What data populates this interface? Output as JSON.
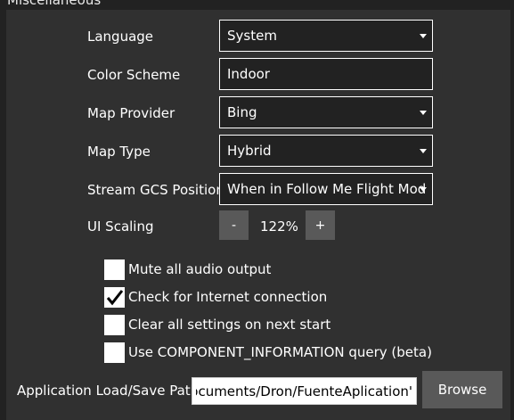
{
  "section_title": "Miscellaneous",
  "rows": {
    "language": {
      "label": "Language",
      "value": "System"
    },
    "color_scheme": {
      "label": "Color Scheme",
      "value": "Indoor"
    },
    "map_provider": {
      "label": "Map Provider",
      "value": "Bing"
    },
    "map_type": {
      "label": "Map Type",
      "value": "Hybrid"
    },
    "stream_gcs": {
      "label": "Stream GCS Position",
      "value": "When in Follow Me Flight Mode"
    }
  },
  "ui_scaling": {
    "label": "UI Scaling",
    "minus": "-",
    "value": "122%",
    "plus": "+"
  },
  "checkboxes": [
    {
      "label": "Mute all audio output",
      "checked": false
    },
    {
      "label": "Check for Internet connection",
      "checked": true
    },
    {
      "label": "Clear all settings on next start",
      "checked": false
    },
    {
      "label": "Use COMPONENT_INFORMATION query (beta)",
      "checked": false
    }
  ],
  "path": {
    "label": "Application Load/Save Path",
    "value": "'Documents/Dron/FuenteAplication",
    "browse_label": "Browse"
  },
  "colors": {
    "background": "#222222",
    "panel": "#303030",
    "button": "#595959"
  }
}
